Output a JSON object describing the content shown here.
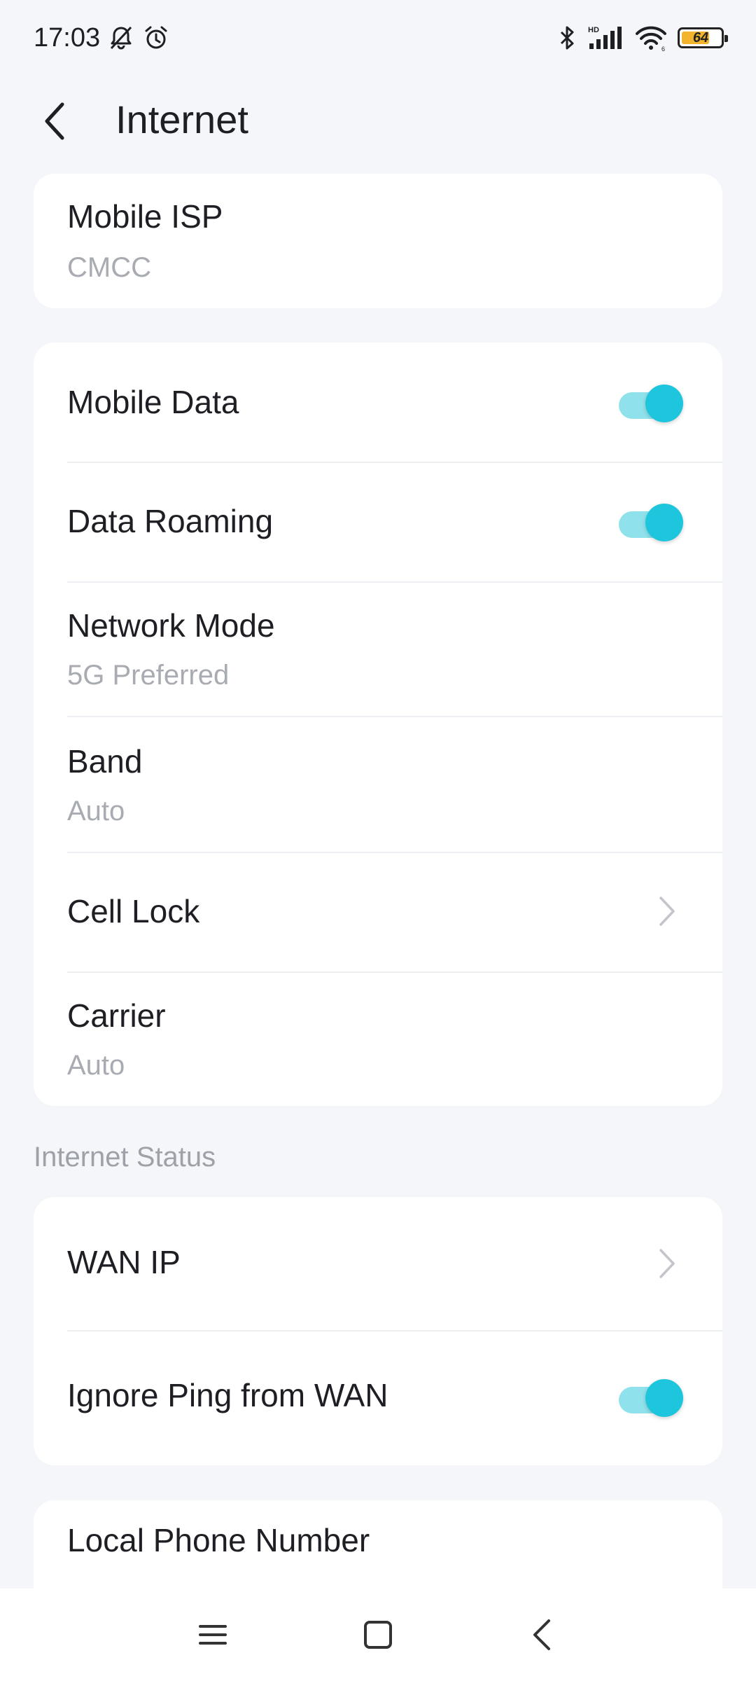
{
  "status_bar": {
    "time": "17:03",
    "battery_level": "64",
    "battery_fraction": 0.64,
    "icons": [
      "bell-off-icon",
      "alarm-icon",
      "bluetooth-icon",
      "hd-signal-icon",
      "wifi-icon",
      "battery-icon"
    ]
  },
  "header": {
    "title": "Internet",
    "back_icon": "chevron-left-icon"
  },
  "isp_card": {
    "title": "Mobile ISP",
    "value": "CMCC"
  },
  "network_card": {
    "mobile_data": {
      "label": "Mobile Data",
      "enabled": true
    },
    "data_roaming": {
      "label": "Data Roaming",
      "enabled": true
    },
    "network_mode": {
      "label": "Network Mode",
      "value": "5G Preferred"
    },
    "band": {
      "label": "Band",
      "value": "Auto"
    },
    "cell_lock": {
      "label": "Cell Lock"
    },
    "carrier": {
      "label": "Carrier",
      "value": "Auto"
    }
  },
  "internet_status": {
    "section_title": "Internet Status",
    "wan_ip": {
      "label": "WAN IP"
    },
    "ignore_ping": {
      "label": "Ignore Ping from WAN",
      "enabled": true
    }
  },
  "phone_card": {
    "label": "Local Phone Number"
  },
  "nav_bar": {
    "icons": [
      "menu-icon",
      "home-square-icon",
      "back-chevron-icon"
    ]
  },
  "colors": {
    "background": "#f4f6fa",
    "card": "#ffffff",
    "accent": "#1ec6dd",
    "accent_track": "#8fe1ec",
    "text_primary": "#1e1f24",
    "text_secondary": "#a9abb2"
  }
}
